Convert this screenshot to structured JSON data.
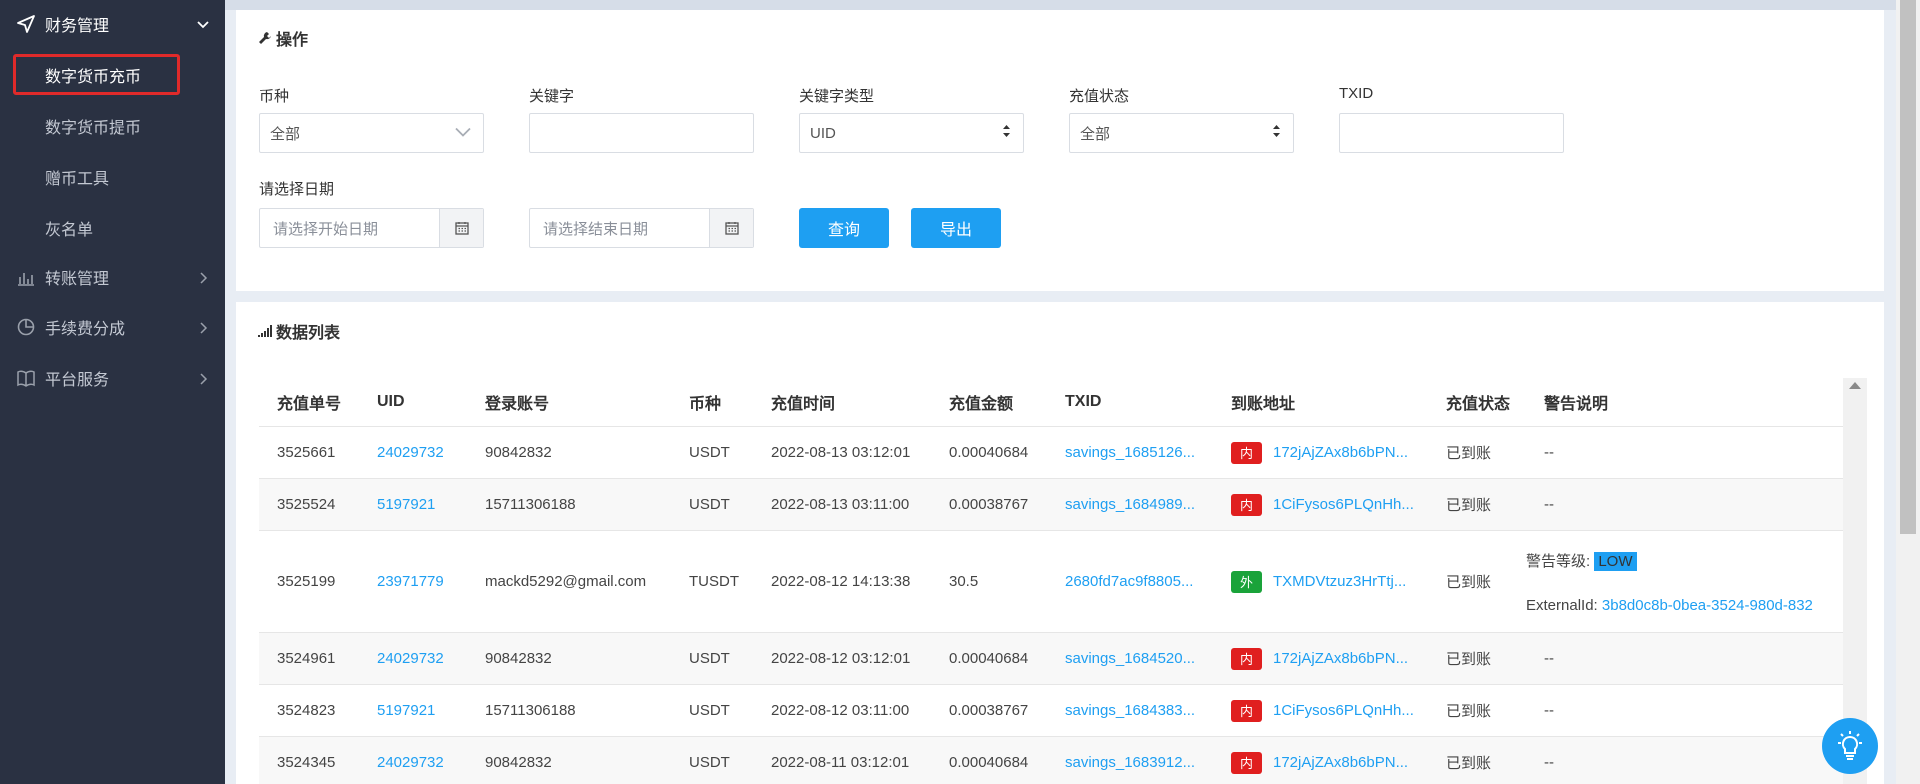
{
  "sidebar": {
    "groups": [
      {
        "label": "财务管理",
        "icon": "send-icon",
        "open": true
      },
      {
        "label": "转账管理",
        "icon": "bar-chart-icon"
      },
      {
        "label": "手续费分成",
        "icon": "pie-chart-icon"
      },
      {
        "label": "平台服务",
        "icon": "book-icon"
      }
    ],
    "finance_items": [
      "数字货币充币",
      "数字货币提币",
      "赠币工具",
      "灰名单"
    ]
  },
  "operations": {
    "title": "操作",
    "labels": {
      "currency": "币种",
      "keyword": "关键字",
      "keyword_type": "关键字类型",
      "status": "充值状态",
      "txid": "TXID",
      "date": "请选择日期"
    },
    "values": {
      "currency": "全部",
      "keyword": "",
      "keyword_type": "UID",
      "status": "全部",
      "txid": ""
    },
    "start_placeholder": "请选择开始日期",
    "end_placeholder": "请选择结束日期",
    "query_button": "查询",
    "export_button": "导出"
  },
  "data_list": {
    "title": "数据列表",
    "headers": [
      "充值单号",
      "UID",
      "登录账号",
      "币种",
      "充值时间",
      "充值金额",
      "TXID",
      "到账地址",
      "充值状态",
      "警告说明"
    ],
    "rows": [
      {
        "id": "3525661",
        "uid": "24029732",
        "account": "90842832",
        "coin": "USDT",
        "time": "2022-08-13 03:12:01",
        "amount": "0.00040684",
        "txid": "savings_1685126...",
        "tag": "内",
        "tag_type": "in",
        "address": "172jAjZAx8b6bPN...",
        "status": "已到账",
        "warning": "--"
      },
      {
        "id": "3525524",
        "uid": "5197921",
        "account": "15711306188",
        "coin": "USDT",
        "time": "2022-08-13 03:11:00",
        "amount": "0.00038767",
        "txid": "savings_1684989...",
        "tag": "内",
        "tag_type": "in",
        "address": "1CiFysos6PLQnHh...",
        "status": "已到账",
        "warning": "--"
      },
      {
        "id": "3525199",
        "uid": "23971779",
        "account": "mackd5292@gmail.com",
        "coin": "TUSDT",
        "time": "2022-08-12 14:13:38",
        "amount": "30.5",
        "txid": "2680fd7ac9f8805...",
        "tag": "外",
        "tag_type": "out",
        "address": "TXMDVtzuz3HrTtj...",
        "status": "已到账",
        "warning": "",
        "warning_level_label": "警告等级:",
        "warning_level": "LOW",
        "external_label": "ExternalId:",
        "external_id": "3b8d0c8b-0bea-3524-980d-832"
      },
      {
        "id": "3524961",
        "uid": "24029732",
        "account": "90842832",
        "coin": "USDT",
        "time": "2022-08-12 03:12:01",
        "amount": "0.00040684",
        "txid": "savings_1684520...",
        "tag": "内",
        "tag_type": "in",
        "address": "172jAjZAx8b6bPN...",
        "status": "已到账",
        "warning": "--"
      },
      {
        "id": "3524823",
        "uid": "5197921",
        "account": "15711306188",
        "coin": "USDT",
        "time": "2022-08-12 03:11:00",
        "amount": "0.00038767",
        "txid": "savings_1684383...",
        "tag": "内",
        "tag_type": "in",
        "address": "1CiFysos6PLQnHh...",
        "status": "已到账",
        "warning": "--"
      },
      {
        "id": "3524345",
        "uid": "24029732",
        "account": "90842832",
        "coin": "USDT",
        "time": "2022-08-11 03:12:01",
        "amount": "0.00040684",
        "txid": "savings_1683912...",
        "tag": "内",
        "tag_type": "in",
        "address": "172jAjZAx8b6bPN...",
        "status": "已到账",
        "warning": "--"
      }
    ]
  },
  "colors": {
    "sidebar": "#2a3142",
    "accent": "#1e9ff2",
    "tag_in": "#e01f1f",
    "tag_out": "#1aa33a",
    "active_outline": "#e02a2a"
  }
}
